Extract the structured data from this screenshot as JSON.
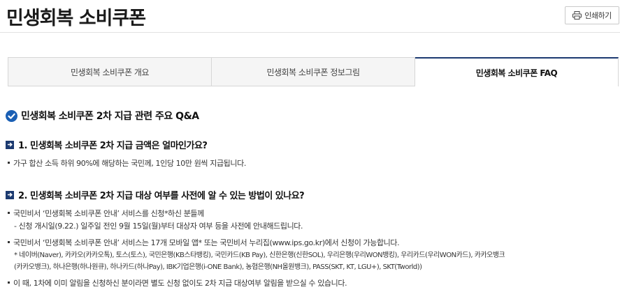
{
  "page": {
    "title": "민생회복 소비쿠폰",
    "print_label": "인쇄하기"
  },
  "tabs": [
    {
      "label": "민생회복 소비쿠폰 개요"
    },
    {
      "label": "민생회복 소비쿠폰 정보그림"
    },
    {
      "label": "민생회복 소비쿠폰 FAQ"
    }
  ],
  "faq": {
    "title": "민생회복 소비쿠폰 2차 지급 관련 주요 Q&A",
    "q1": {
      "question": "1. 민생회복 소비쿠폰 2차 지급 금액은 얼마인가요?",
      "answer": "가구 합산 소득 하위 90%에 해당하는 국민께, 1인당 10만 원씩 지급됩니다."
    },
    "q2": {
      "question": "2. 민생회복 소비쿠폰 2차 지급 대상 여부를 사전에 알 수 있는 방법이 있나요?",
      "a1_line1": "국민비서 ‘민생회복 소비쿠폰 안내’ 서비스를 신청*하신 분들께",
      "a1_line2": "- 신청 개시일(9.22.) 일주일 전인 9월 15일(월)부터 대상자 여부 등을 사전에 안내해드립니다.",
      "a2_line1": "국민비서 ‘민생회복 소비쿠폰 안내’ 서비스는 17개 모바일 앱* 또는 국민비서 누리집(www.ips.go.kr)에서 신청이 가능합니다.",
      "a2_line2": "* 네이버(Naver), 카카오(카카오톡), 토스(토스), 국민은행(KB스타뱅킹), 국민카드(KB Pay), 신한은행(신한SOL), 우리은행(우리WON뱅킹), 우리카드(우리WON카드), 카카오뱅크",
      "a2_line3": "(카카오뱅크), 하나은행(하나원큐), 하나카드(하나Pay), IBK기업은행(i-ONE Bank), 농협은행(NH올원뱅크), PASS(SKT, KT, LGU+), SKT(Tworld))",
      "a3": "이 때, 1차에 이미 알림을 신청하신 분이라면 별도 신청 없이도 2차 지급 대상여부 알림을 받으실 수 있습니다."
    }
  },
  "colors": {
    "accent": "#1c3a70",
    "check": "#1a5fb4"
  }
}
